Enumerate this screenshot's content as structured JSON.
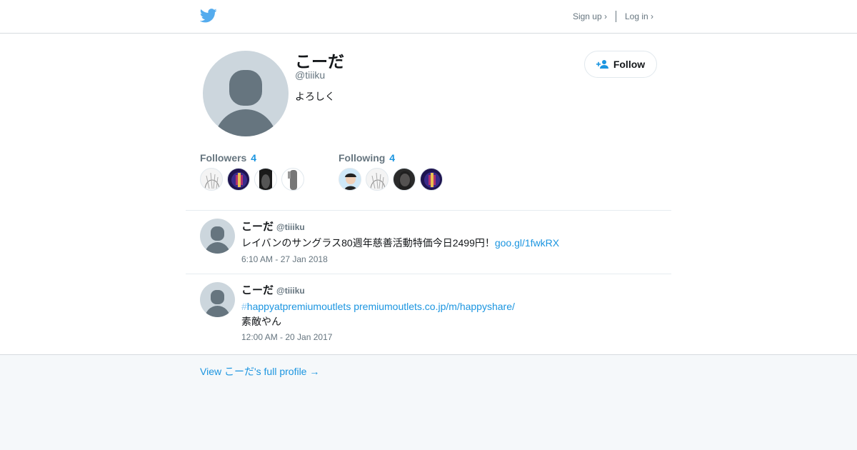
{
  "header": {
    "signup_label": "Sign up ›",
    "login_label": "Log in ›",
    "brand_color": "#55acee"
  },
  "profile": {
    "name": "こーだ",
    "handle": "@tiiiku",
    "bio": "よろしく",
    "follow_label": "Follow",
    "followers_label": "Followers",
    "followers_count": "4",
    "following_label": "Following",
    "following_count": "4"
  },
  "tweets": [
    {
      "name": "こーだ",
      "handle": "@tiiiku",
      "text": "レイバンのサングラス80週年慈善活動特価今日2499円！",
      "link": "goo.gl/1fwkRX",
      "time": "6:10 AM - 27 Jan 2018"
    },
    {
      "name": "こーだ",
      "handle": "@tiiiku",
      "hash_symbol": "#",
      "hashtag": "happyatpremiumoutlets",
      "link": "premiumoutlets.co.jp/m/happyshare/",
      "text2": "素敵やん",
      "time": "12:00 AM - 20 Jan 2017"
    }
  ],
  "footer": {
    "full_profile_label": "View こーだ's full profile →"
  },
  "colors": {
    "link": "#1b95e0",
    "muted": "#66757f",
    "avatar_bg": "#ccd6dd",
    "avatar_fg": "#66757f"
  }
}
